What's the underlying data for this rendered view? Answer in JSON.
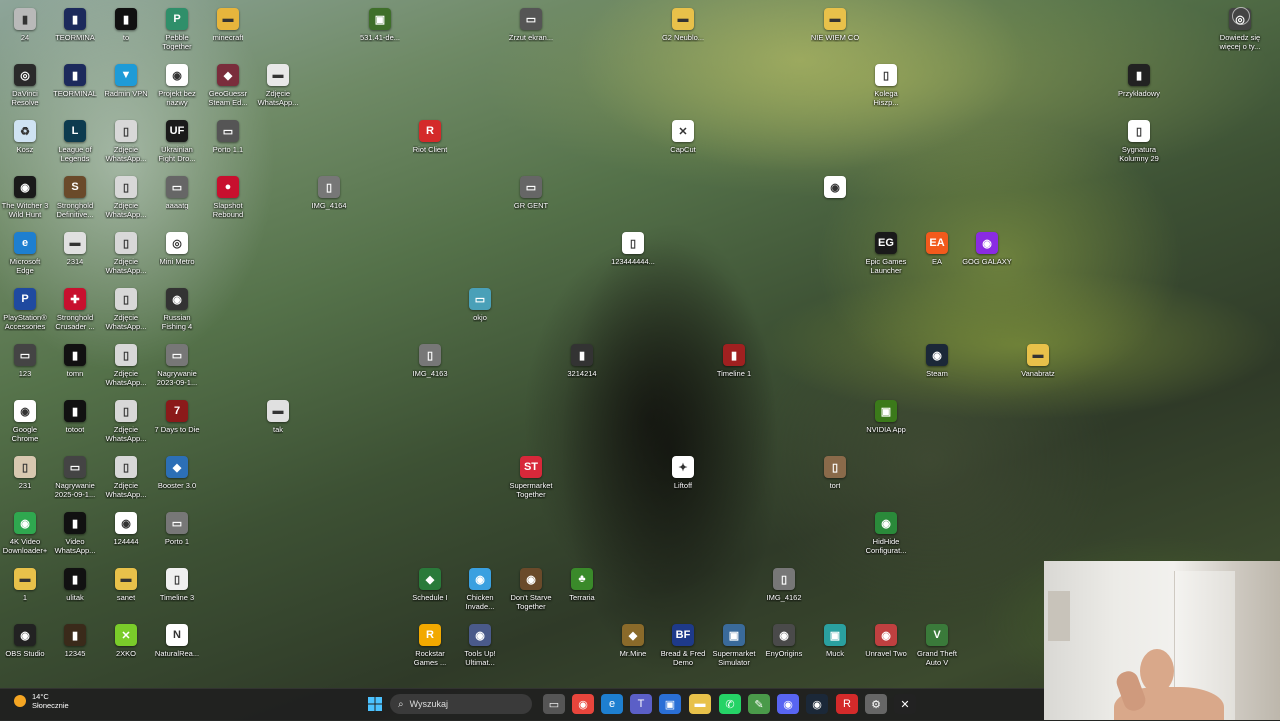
{
  "desktop_icons": [
    {
      "label": "24",
      "color": "#b9b9b9",
      "glyph": "▮"
    },
    {
      "label": "TEORMINA",
      "color": "#1c2a5c",
      "glyph": "▮"
    },
    {
      "label": "to",
      "color": "#111111",
      "glyph": "▮"
    },
    {
      "label": "Pebble Together",
      "color": "#2f8f6a",
      "glyph": "P"
    },
    {
      "label": "minecraft",
      "color": "#e7b53c",
      "glyph": "▬"
    },
    {
      "label": "531.41-de...",
      "color": "#3f6f2a",
      "glyph": "▣"
    },
    {
      "label": "Zrzut ekran...",
      "color": "#555555",
      "glyph": "▭"
    },
    {
      "label": "G2 Neublo...",
      "color": "#e8c14a",
      "glyph": "▬"
    },
    {
      "label": "NIE WIEM CO",
      "color": "#e8c14a",
      "glyph": "▬"
    },
    {
      "label": "DaVinci Resolve",
      "color": "#2a2a2a",
      "glyph": "◎"
    },
    {
      "label": "TEORMINAL",
      "color": "#1c2a5c",
      "glyph": "▮"
    },
    {
      "label": "Radmin VPN",
      "color": "#1e9bd7",
      "glyph": "▼"
    },
    {
      "label": "Projekt bez nazwy",
      "color": "#ffffff",
      "glyph": "◉"
    },
    {
      "label": "GeoGuessr Steam Ed...",
      "color": "#7a2d3c",
      "glyph": "◆"
    },
    {
      "label": "Zdjęcie WhatsApp...",
      "color": "#e8e8e8",
      "glyph": "▬"
    },
    {
      "label": "Kolega Hiszp...",
      "color": "#ffffff",
      "glyph": "▯"
    },
    {
      "label": "Przykładowy",
      "color": "#222222",
      "glyph": "▮"
    },
    {
      "label": "Kosz",
      "color": "#cfe3f3",
      "glyph": "♻"
    },
    {
      "label": "League of Legends",
      "color": "#0d3b4f",
      "glyph": "L"
    },
    {
      "label": "Zdjęcie WhatsApp...",
      "color": "#d8d8d8",
      "glyph": "▯"
    },
    {
      "label": "Ukrainian Fight Dro...",
      "color": "#1a1a1a",
      "glyph": "UF"
    },
    {
      "label": "Porto 1.1",
      "color": "#555555",
      "glyph": "▭"
    },
    {
      "label": "Riot Client",
      "color": "#d42a2a",
      "glyph": "R"
    },
    {
      "label": "CapCut",
      "color": "#ffffff",
      "glyph": "✕"
    },
    {
      "label": "Sygnatura Kolumny 29",
      "color": "#ffffff",
      "glyph": "▯"
    },
    {
      "label": "The Witcher 3 Wild Hunt",
      "color": "#1a1a1a",
      "glyph": "◉"
    },
    {
      "label": "Stronghold Definitive...",
      "color": "#6a4a2a",
      "glyph": "S"
    },
    {
      "label": "Zdjęcie WhatsApp...",
      "color": "#d8d8d8",
      "glyph": "▯"
    },
    {
      "label": "aaaatg",
      "color": "#666666",
      "glyph": "▭"
    },
    {
      "label": "Slapshot Rebound",
      "color": "#c8102e",
      "glyph": "●"
    },
    {
      "label": "IMG_4164",
      "color": "#777777",
      "glyph": "▯"
    },
    {
      "label": "GR GENT",
      "color": "#666666",
      "glyph": "▭"
    },
    {
      "label": "",
      "color": "#ffffff",
      "glyph": "◉"
    },
    {
      "label": "Microsoft Edge",
      "color": "#1e7fd0",
      "glyph": "e"
    },
    {
      "label": "2314",
      "color": "#e0e0e0",
      "glyph": "▬"
    },
    {
      "label": "Zdjęcie WhatsApp...",
      "color": "#d8d8d8",
      "glyph": "▯"
    },
    {
      "label": "Mini Metro",
      "color": "#ffffff",
      "glyph": "◎"
    },
    {
      "label": "123444444...",
      "color": "#ffffff",
      "glyph": "▯"
    },
    {
      "label": "Epic Games Launcher",
      "color": "#1a1a1a",
      "glyph": "EG"
    },
    {
      "label": "EA",
      "color": "#f25a1c",
      "glyph": "EA"
    },
    {
      "label": "GOG GALAXY",
      "color": "#8a2be2",
      "glyph": "◉"
    },
    {
      "label": "PlayStation® Accessories",
      "color": "#1f4aa0",
      "glyph": "P"
    },
    {
      "label": "Stronghold Crusader ...",
      "color": "#c8102e",
      "glyph": "✚"
    },
    {
      "label": "Zdjęcie WhatsApp...",
      "color": "#d8d8d8",
      "glyph": "▯"
    },
    {
      "label": "Russian Fishing 4",
      "color": "#333333",
      "glyph": "◉"
    },
    {
      "label": "okjo",
      "color": "#4aa0b8",
      "glyph": "▭"
    },
    {
      "label": "123",
      "color": "#444444",
      "glyph": "▭"
    },
    {
      "label": "tomn",
      "color": "#111111",
      "glyph": "▮"
    },
    {
      "label": "Zdjęcie WhatsApp...",
      "color": "#d8d8d8",
      "glyph": "▯"
    },
    {
      "label": "Nagrywanie 2023-09-1...",
      "color": "#777777",
      "glyph": "▭"
    },
    {
      "label": "IMG_4163",
      "color": "#777777",
      "glyph": "▯"
    },
    {
      "label": "3214214",
      "color": "#333333",
      "glyph": "▮"
    },
    {
      "label": "Timeline 1",
      "color": "#a02020",
      "glyph": "▮"
    },
    {
      "label": "Steam",
      "color": "#1b2838",
      "glyph": "◉"
    },
    {
      "label": "Vanabratz",
      "color": "#e8c14a",
      "glyph": "▬"
    },
    {
      "label": "Google Chrome",
      "color": "#ffffff",
      "glyph": "◉"
    },
    {
      "label": "totoot",
      "color": "#111111",
      "glyph": "▮"
    },
    {
      "label": "Zdjęcie WhatsApp...",
      "color": "#d8d8d8",
      "glyph": "▯"
    },
    {
      "label": "7 Days to Die",
      "color": "#8b1a1a",
      "glyph": "7"
    },
    {
      "label": "tak",
      "color": "#e0e0e0",
      "glyph": "▬"
    },
    {
      "label": "NVIDIA App",
      "color": "#3b7a1a",
      "glyph": "▣"
    },
    {
      "label": "231",
      "color": "#d8c8b0",
      "glyph": "▯"
    },
    {
      "label": "Nagrywanie 2025-09-1...",
      "color": "#444444",
      "glyph": "▭"
    },
    {
      "label": "Zdjęcie WhatsApp...",
      "color": "#d8d8d8",
      "glyph": "▯"
    },
    {
      "label": "Booster 3.0",
      "color": "#2c6fb6",
      "glyph": "◆"
    },
    {
      "label": "Supermarket Together",
      "color": "#d8283a",
      "glyph": "ST"
    },
    {
      "label": "Liftoff",
      "color": "#ffffff",
      "glyph": "✦"
    },
    {
      "label": "tort",
      "color": "#8a6a4a",
      "glyph": "▯"
    },
    {
      "label": "4K Video Downloader+",
      "color": "#2fa84f",
      "glyph": "◉"
    },
    {
      "label": "Video WhatsApp...",
      "color": "#111111",
      "glyph": "▮"
    },
    {
      "label": "124444",
      "color": "#ffffff",
      "glyph": "◉"
    },
    {
      "label": "Porto 1",
      "color": "#777777",
      "glyph": "▭"
    },
    {
      "label": "HidHide Configurat...",
      "color": "#2a8a3a",
      "glyph": "◉"
    },
    {
      "label": "1",
      "color": "#e8c14a",
      "glyph": "▬"
    },
    {
      "label": "ulitak",
      "color": "#111111",
      "glyph": "▮"
    },
    {
      "label": "sanet",
      "color": "#e8c14a",
      "glyph": "▬"
    },
    {
      "label": "Timeline 3",
      "color": "#f0f0f0",
      "glyph": "▯"
    },
    {
      "label": "Schedule I",
      "color": "#2a7a3a",
      "glyph": "◆"
    },
    {
      "label": "Chicken Invade...",
      "color": "#3aa0e0",
      "glyph": "◉"
    },
    {
      "label": "Don't Starve Together",
      "color": "#6a4a2a",
      "glyph": "◉"
    },
    {
      "label": "Terraria",
      "color": "#3a8a2a",
      "glyph": "♣"
    },
    {
      "label": "IMG_4162",
      "color": "#777777",
      "glyph": "▯"
    },
    {
      "label": "OBS Studio",
      "color": "#222222",
      "glyph": "◉"
    },
    {
      "label": "12345",
      "color": "#3a2a1a",
      "glyph": "▮"
    },
    {
      "label": "2XKO",
      "color": "#7acc2a",
      "glyph": "✕"
    },
    {
      "label": "NaturalRea...",
      "color": "#ffffff",
      "glyph": "N"
    },
    {
      "label": "Rockstar Games ...",
      "color": "#f2a900",
      "glyph": "R"
    },
    {
      "label": "Tools Up! Ultimat...",
      "color": "#4a5a8a",
      "glyph": "◉"
    },
    {
      "label": "Mr.Mine",
      "color": "#8a6a2a",
      "glyph": "◆"
    },
    {
      "label": "Bread & Fred Demo",
      "color": "#1e3a8a",
      "glyph": "BF"
    },
    {
      "label": "Supermarket Simulator",
      "color": "#3a6a9a",
      "glyph": "▣"
    },
    {
      "label": "EnyOrigins",
      "color": "#4a4a4a",
      "glyph": "◉"
    },
    {
      "label": "Muck",
      "color": "#2aa0a0",
      "glyph": "▣"
    },
    {
      "label": "Unravel Two",
      "color": "#c04040",
      "glyph": "◉"
    },
    {
      "label": "Grand Theft Auto V",
      "color": "#3a7a3a",
      "glyph": "V"
    },
    {
      "label": "Dowiedz się więcej o ty...",
      "color": "#444444",
      "glyph": "◎"
    }
  ],
  "taskbar": {
    "weather": {
      "temp": "14°C",
      "desc": "Słonecznie"
    },
    "search_placeholder": "Wyszukaj",
    "apps": [
      {
        "name": "file-explorer",
        "glyph": "▭",
        "color": "#555555"
      },
      {
        "name": "chrome",
        "glyph": "◉",
        "color": "#e8453c"
      },
      {
        "name": "edge",
        "glyph": "e",
        "color": "#1e7fd0"
      },
      {
        "name": "teams",
        "glyph": "T",
        "color": "#5b5fc7"
      },
      {
        "name": "store",
        "glyph": "▣",
        "color": "#2a6fd6"
      },
      {
        "name": "folder",
        "glyph": "▬",
        "color": "#e8c14a"
      },
      {
        "name": "whatsapp",
        "glyph": "✆",
        "color": "#25d366"
      },
      {
        "name": "notepad",
        "glyph": "✎",
        "color": "#4a9a4a"
      },
      {
        "name": "discord",
        "glyph": "◉",
        "color": "#5865f2"
      },
      {
        "name": "steam",
        "glyph": "◉",
        "color": "#1b2838"
      },
      {
        "name": "riot",
        "glyph": "R",
        "color": "#d42a2a"
      },
      {
        "name": "settings",
        "glyph": "⚙",
        "color": "#666666"
      },
      {
        "name": "capcut",
        "glyph": "✕",
        "color": "#222222"
      }
    ]
  }
}
